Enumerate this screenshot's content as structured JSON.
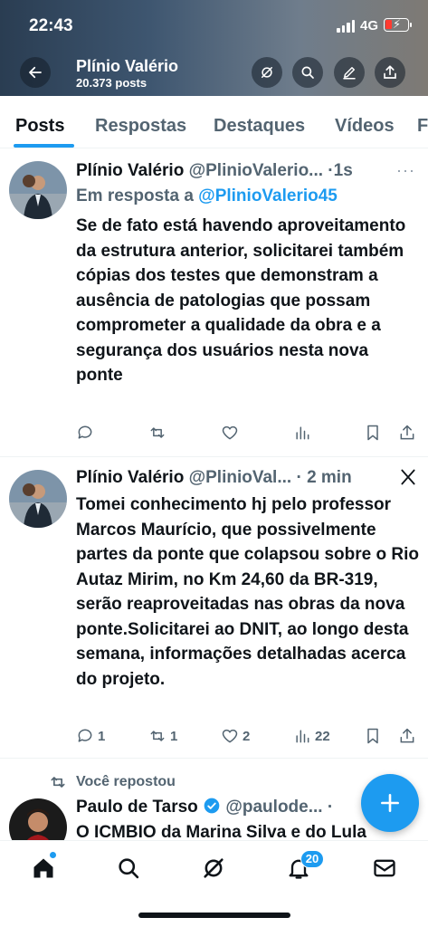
{
  "status": {
    "time": "22:43",
    "network": "4G"
  },
  "header": {
    "name": "Plínio Valério",
    "post_count": "20.373 posts"
  },
  "tabs": [
    {
      "label": "Posts"
    },
    {
      "label": "Respostas"
    },
    {
      "label": "Destaques"
    },
    {
      "label": "Vídeos"
    },
    {
      "label": "F"
    }
  ],
  "posts": [
    {
      "name": "Plínio Valério",
      "handle": "@PlinioValerio... ·",
      "time": "1s",
      "reply_prefix": "Em resposta a ",
      "reply_handle": "@PlinioValerio45",
      "text": "Se de fato está havendo aproveitamento da estrutura anterior, solicitarei também cópias dos testes que demonstram a ausência de patologias que possam comprometer a qualidade da obra e a segurança dos usuários nesta nova ponte",
      "more": "···"
    },
    {
      "name": "Plínio Valério",
      "handle": "@PlinioVal... ·",
      "time": "2 min",
      "text": "Tomei conhecimento hj pelo professor Marcos Maurício, que possivelmente partes da ponte que colapsou sobre o Rio Autaz Mirim, no Km 24,60 da BR-319, serão reaproveitadas nas obras da nova ponte.Solicitarei ao DNIT, ao longo desta semana, informações detalhadas acerca do projeto.",
      "replies": "1",
      "reposts": "1",
      "likes": "2",
      "views": "22"
    },
    {
      "repost_label": "Você repostou",
      "name": "Paulo de Tarso",
      "handle": "@paulode... ·",
      "text": "O ICMBIO da Marina Silva e do Lula"
    }
  ],
  "nav": {
    "notifications_badge": "20"
  },
  "colors": {
    "accent": "#1d9bf0",
    "text": "#0f1419",
    "muted": "#536471"
  }
}
